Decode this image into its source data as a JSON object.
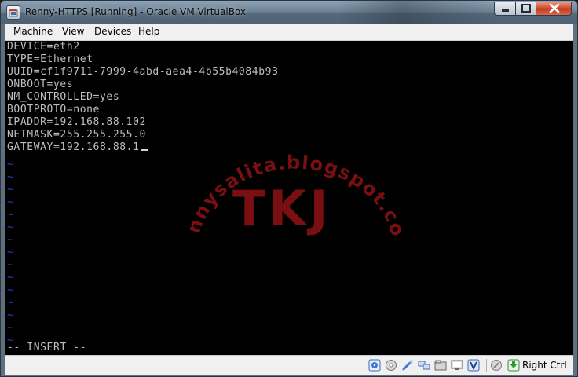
{
  "window": {
    "title": "Renny-HTTPS [Running] - Oracle VM VirtualBox"
  },
  "menu": {
    "items": [
      "Machine",
      "View",
      "Devices",
      "Help"
    ]
  },
  "terminal": {
    "lines": [
      "DEVICE=eth2",
      "TYPE=Ethernet",
      "UUID=cf1f9711-7999-4abd-aea4-4b55b4084b93",
      "ONBOOT=yes",
      "NM_CONTROLLED=yes",
      "BOOTPROTO=none",
      "IPADDR=192.168.88.102",
      "NETMASK=255.255.255.0",
      "GATEWAY=192.168.88.1"
    ],
    "empty_line_marker": "~",
    "empty_line_count": 15,
    "mode_line": "-- INSERT --",
    "text_color": "#bfbfbf",
    "tilde_color": "#1f3fd0"
  },
  "watermark": {
    "arc_text": "rennysalita.blogspot.com",
    "center_text": "TKJ",
    "color": "#7a0f12"
  },
  "statusbar": {
    "icons": [
      "hard-disk-icon",
      "optical-drive-icon",
      "usb-icon",
      "network-icon",
      "shared-folders-icon",
      "display-icon",
      "virtualization-icon",
      "mouse-integration-icon",
      "keyboard-capture-icon"
    ],
    "host_key_label": "Right Ctrl"
  }
}
